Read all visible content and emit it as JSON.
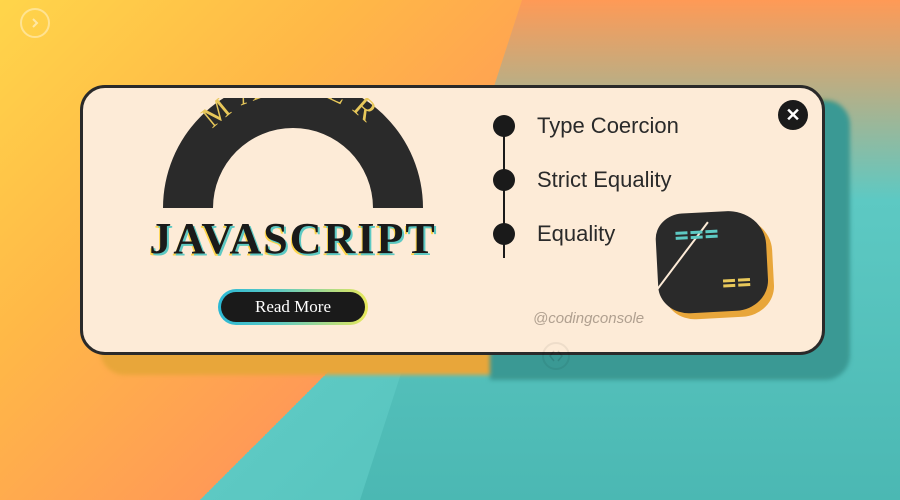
{
  "badge": {
    "arc_word": "MASTER",
    "title": "JAVASCRIPT"
  },
  "cta": {
    "read_more": "Read More"
  },
  "topics": [
    "Type Coercion",
    "Strict Equality",
    "Equality"
  ],
  "handle": "@codingconsole",
  "close_label": "✕",
  "colors": {
    "dark": "#1a1a1a",
    "cream": "#fdebd7",
    "teal": "#5dc9c3",
    "yellow": "#ffd54a"
  }
}
